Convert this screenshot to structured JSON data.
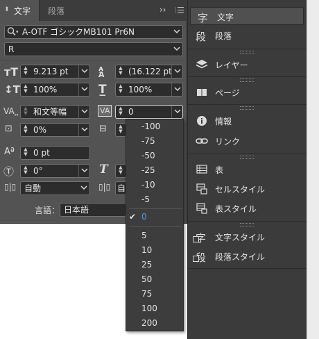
{
  "panel": {
    "tabs": [
      {
        "label": "文字"
      },
      {
        "label": "段落"
      }
    ],
    "collapse_glyph": "››",
    "font_family": "A-OTF ゴシックMB101 Pr6N",
    "font_style": "R",
    "font_size": "9.213 pt",
    "leading": "(16.122 pt",
    "vertical_scale": "100%",
    "horizontal_scale": "100%",
    "kerning": "和文等幅",
    "tracking": "0",
    "tsume": "0%",
    "baseline_shift": "0 pt",
    "rotation": "0°",
    "aki_before": "自動",
    "aki_after": "自",
    "language_label": "言語：",
    "language": "日本語"
  },
  "tracking_dropdown": {
    "options": [
      "-100",
      "-75",
      "-50",
      "-25",
      "-10",
      "-5",
      "0",
      "5",
      "10",
      "25",
      "50",
      "75",
      "100",
      "200"
    ],
    "selected": "0",
    "selected_color": "#4a9fe5"
  },
  "side_panel": {
    "items": [
      {
        "label": "文字",
        "icon": "character-icon",
        "glyph": "字"
      },
      {
        "label": "段落",
        "icon": "paragraph-icon",
        "glyph": "段"
      },
      {
        "label": "レイヤー",
        "icon": "layers-icon"
      },
      {
        "label": "ページ",
        "icon": "pages-icon"
      },
      {
        "label": "情報",
        "icon": "info-icon"
      },
      {
        "label": "リンク",
        "icon": "links-icon"
      },
      {
        "label": "表",
        "icon": "table-icon"
      },
      {
        "label": "セルスタイル",
        "icon": "cell-style-icon"
      },
      {
        "label": "表スタイル",
        "icon": "table-style-icon"
      },
      {
        "label": "文字スタイル",
        "icon": "character-style-icon"
      },
      {
        "label": "段落スタイル",
        "icon": "paragraph-style-icon"
      }
    ]
  },
  "colors": {
    "panel_bg": "#535353",
    "field_bg": "#2c2c2c",
    "dark_bg": "#3a3a3a",
    "accent": "#4a9fe5"
  }
}
